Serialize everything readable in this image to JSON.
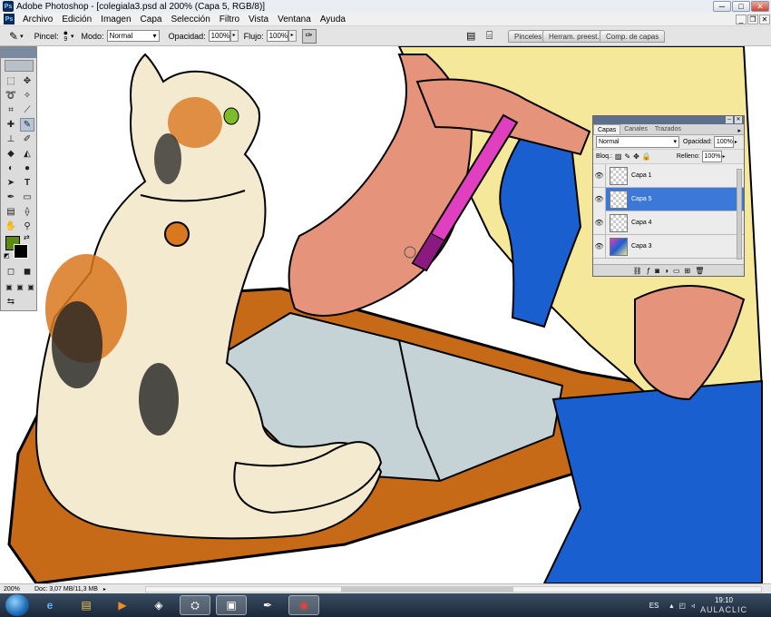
{
  "window": {
    "title": "Adobe Photoshop - [colegiala3.psd al 200% (Capa 5, RGB/8)]"
  },
  "app_icon_text": "Ps",
  "menu": [
    "Archivo",
    "Edición",
    "Imagen",
    "Capa",
    "Selección",
    "Filtro",
    "Vista",
    "Ventana",
    "Ayuda"
  ],
  "options": {
    "brush_label": "Pincel:",
    "brush_size": "9",
    "mode_label": "Modo:",
    "mode_value": "Normal",
    "opacity_label": "Opacidad:",
    "opacity_value": "100%",
    "flow_label": "Flujo:",
    "flow_value": "100%"
  },
  "panel_well_tabs": [
    "Pinceles",
    "Herram. preest.",
    "Comp. de capas"
  ],
  "layers_panel": {
    "tabs": [
      "Capas",
      "Canales",
      "Trazados"
    ],
    "blend_mode": "Normal",
    "opacity_label": "Opacidad:",
    "opacity_value": "100%",
    "lock_label": "Bloq.:",
    "fill_label": "Relleno:",
    "fill_value": "100%",
    "layers": [
      {
        "name": "Capa 1",
        "visible": true,
        "selected": false
      },
      {
        "name": "Capa 5",
        "visible": true,
        "selected": true
      },
      {
        "name": "Capa 4",
        "visible": true,
        "selected": false
      },
      {
        "name": "Capa 3",
        "visible": true,
        "selected": false
      }
    ]
  },
  "status": {
    "zoom": "200%",
    "doc": "Doc: 3,07 MB/11,3 MB"
  },
  "taskbar": {
    "language": "ES",
    "time": "19:10",
    "watermark": "AULACLIC"
  },
  "colors": {
    "foreground": "#5e8a12",
    "background": "#000000",
    "selection": "#3c78d8"
  }
}
